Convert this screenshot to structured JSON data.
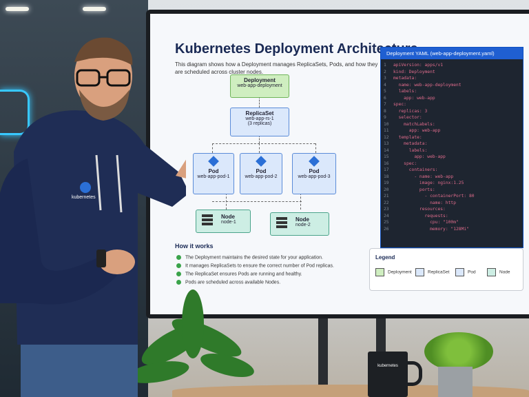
{
  "screen": {
    "title": "Kubernetes Deployment Architecture",
    "description": "This diagram shows how a Deployment manages ReplicaSets, Pods, and how they are scheduled across cluster nodes.",
    "deployment": {
      "label": "Deployment",
      "name": "web-app-deployment"
    },
    "replicaset": {
      "label": "ReplicaSet",
      "name": "web-app-rs-1",
      "note": "(3 replicas)"
    },
    "pods": [
      {
        "label": "Pod",
        "name": "web-app-pod-1"
      },
      {
        "label": "Pod",
        "name": "web-app-pod-2"
      },
      {
        "label": "Pod",
        "name": "web-app-pod-3"
      }
    ],
    "nodes": [
      {
        "label": "Node",
        "name": "node-1"
      },
      {
        "label": "Node",
        "name": "node-2"
      }
    ],
    "how_title": "How it works",
    "how_items": [
      "The Deployment maintains the desired state for your application.",
      "It manages ReplicaSets to ensure the correct number of Pod replicas.",
      "The ReplicaSet ensures Pods are running and healthy.",
      "Pods are scheduled across available Nodes."
    ],
    "yaml_title": "Deployment YAML (web-app-deployment.yaml)",
    "yaml_lines": [
      "apiVersion: apps/v1",
      "kind: Deployment",
      "metadata:",
      "  name: web-app-deployment",
      "  labels:",
      "    app: web-app",
      "spec:",
      "  replicas: 3",
      "  selector:",
      "    matchLabels:",
      "      app: web-app",
      "  template:",
      "    metadata:",
      "      labels:",
      "        app: web-app",
      "    spec:",
      "      containers:",
      "        - name: web-app",
      "          image: nginx:1.25",
      "          ports:",
      "            - containerPort: 80",
      "              name: http",
      "          resources:",
      "            requests:",
      "              cpu: \"100m\"",
      "              memory: \"128Mi\""
    ],
    "legend_title": "Legend",
    "legend": [
      {
        "label": "Deployment",
        "color": "#cfeec0"
      },
      {
        "label": "ReplicaSet",
        "color": "#dbe8fb"
      },
      {
        "label": "Pod",
        "color": "#dbe8fb"
      },
      {
        "label": "Node",
        "color": "#cdeee4"
      }
    ]
  },
  "hoodie_logo": "kubernetes",
  "mug_logo": "kubernetes"
}
